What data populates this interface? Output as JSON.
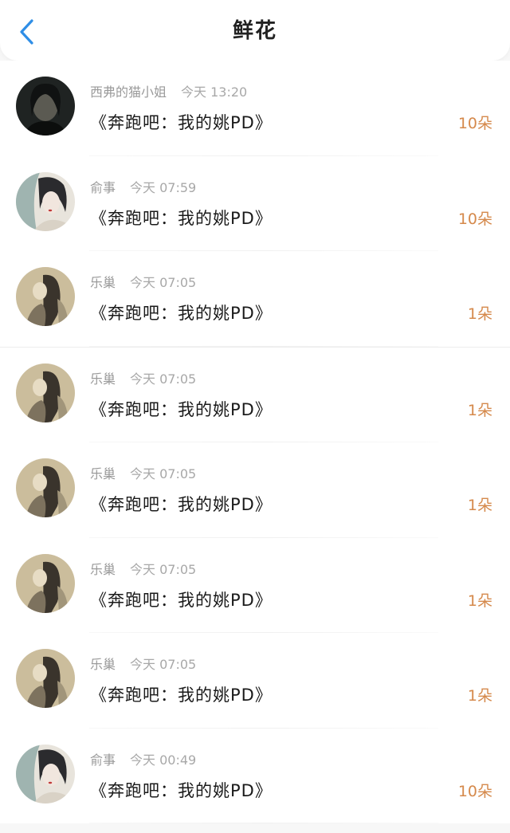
{
  "header": {
    "title": "鲜花"
  },
  "colors": {
    "accent": "#2f8ee6",
    "count": "#d5894b"
  },
  "items": [
    {
      "user": "西弗的猫小姐",
      "time": "今天 13:20",
      "book": "《奔跑吧：我的姚PD》",
      "count": "10朵",
      "avatar": "dark-portrait"
    },
    {
      "user": "俞事",
      "time": "今天 07:59",
      "book": "《奔跑吧：我的姚PD》",
      "count": "10朵",
      "avatar": "ink-portrait"
    },
    {
      "user": "乐巢",
      "time": "今天 07:05",
      "book": "《奔跑吧：我的姚PD》",
      "count": "1朵",
      "avatar": "sepia-portrait"
    },
    {
      "user": "乐巢",
      "time": "今天 07:05",
      "book": "《奔跑吧：我的姚PD》",
      "count": "1朵",
      "avatar": "sepia-portrait"
    },
    {
      "user": "乐巢",
      "time": "今天 07:05",
      "book": "《奔跑吧：我的姚PD》",
      "count": "1朵",
      "avatar": "sepia-portrait"
    },
    {
      "user": "乐巢",
      "time": "今天 07:05",
      "book": "《奔跑吧：我的姚PD》",
      "count": "1朵",
      "avatar": "sepia-portrait"
    },
    {
      "user": "乐巢",
      "time": "今天 07:05",
      "book": "《奔跑吧：我的姚PD》",
      "count": "1朵",
      "avatar": "sepia-portrait"
    },
    {
      "user": "俞事",
      "time": "今天 00:49",
      "book": "《奔跑吧：我的姚PD》",
      "count": "10朵",
      "avatar": "ink-portrait"
    }
  ]
}
